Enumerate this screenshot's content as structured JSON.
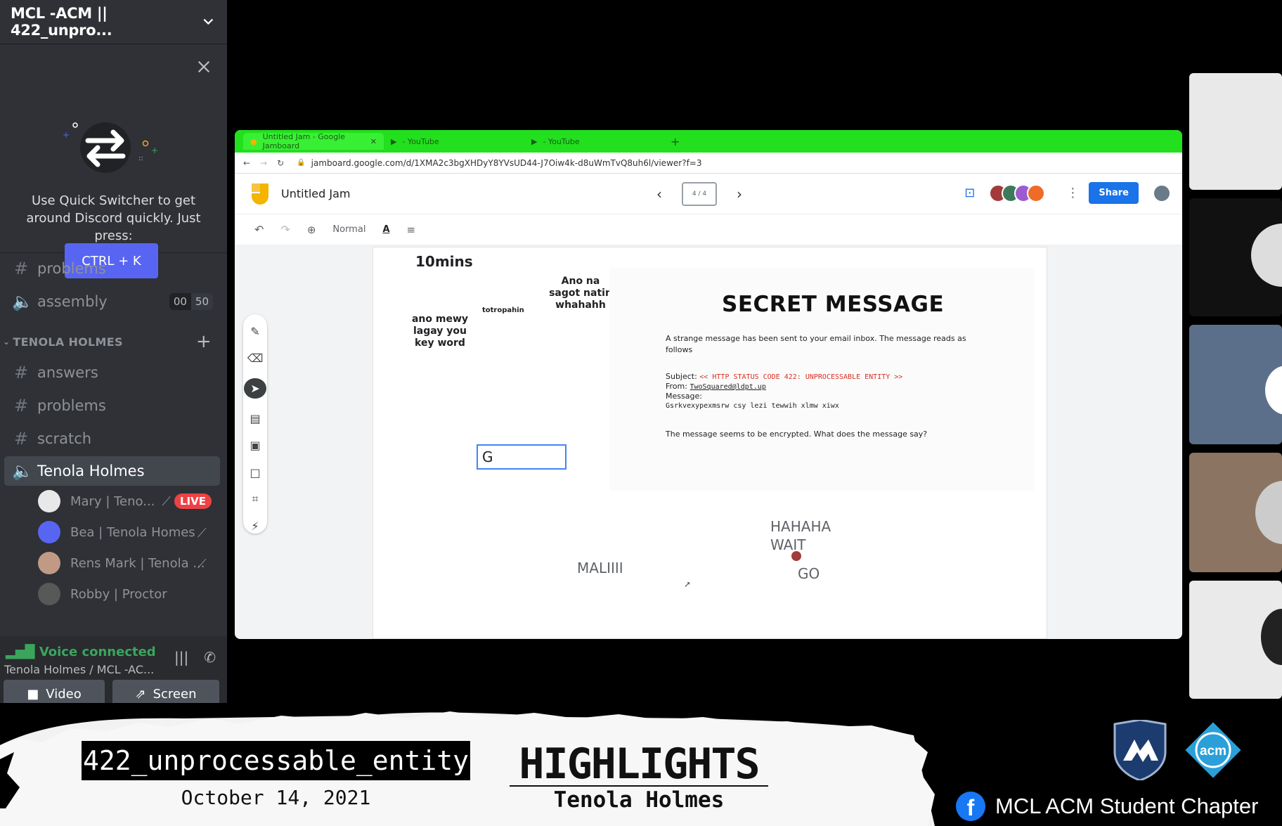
{
  "server": {
    "name": "MCL -ACM || 422_unpro..."
  },
  "quick_switcher": {
    "text": "Use Quick Switcher to get around Discord quickly. Just press:",
    "shortcut": "CTRL + K"
  },
  "channels": {
    "top": [
      {
        "name": "problems",
        "type": "text"
      },
      {
        "name": "assembly",
        "type": "voice",
        "counts": [
          "00",
          "50"
        ]
      }
    ],
    "category": "TENOLA HOLMES",
    "items": [
      {
        "name": "answers",
        "type": "text"
      },
      {
        "name": "problems",
        "type": "text"
      },
      {
        "name": "scratch",
        "type": "text"
      },
      {
        "name": "Tenola Holmes",
        "type": "voice"
      }
    ],
    "members": [
      {
        "name": "Mary | Teno...",
        "badge": "LIVE",
        "muted": true
      },
      {
        "name": "Bea | Tenola Homes",
        "muted": true
      },
      {
        "name": "Rens Mark | Tenola ...",
        "muted": true
      },
      {
        "name": "Robby | Proctor",
        "muted": false
      }
    ]
  },
  "voice": {
    "status": "Voice connected",
    "location": "Tenola Holmes / MCL -AC...",
    "video_label": "Video",
    "screen_label": "Screen"
  },
  "jamboard": {
    "url": "jamboard.google.com/d/1XMA2c3bgXHDyY8YVsUD44-J7Oiw4k-d8uWmTvQ8uh6l/viewer?f=3",
    "tabs": [
      "Untitled Jam - Google Jamboard",
      "- YouTube",
      "- YouTube"
    ],
    "title": "Untitled Jam",
    "frame_counter": "4 / 4",
    "share_label": "Share",
    "toolbar_font": "Normal",
    "notes": {
      "timer": "10mins",
      "ano_na": "Ano na sagot natin whahahh",
      "totropahin": "totropahin",
      "ano_mewy": "ano mewy lagay you key word"
    },
    "puzzle": {
      "title": "SECRET MESSAGE",
      "intro": "A strange message has been sent to your email inbox. The message reads as follows",
      "subject_label": "Subject:",
      "subject": "<< HTTP STATUS CODE 422: UNPROCESSABLE ENTITY >>",
      "from_label": "From:",
      "from": "TwoSquared@ldpt.up",
      "message_label": "Message:",
      "message": "Gsrkvexypexmsrw csy lezi tewwih xlmw xiwx",
      "question": "The message seems to be encrypted. What does the message say?"
    },
    "input_value": "G",
    "scribbles": {
      "hahaha": "HAHAHA",
      "wait": "WAIT",
      "go": "GO",
      "maliiii": "MALIIII"
    }
  },
  "banner": {
    "event": "422_unprocessable_entity",
    "date": "October 14, 2021",
    "title": "HIGHLIGHTS",
    "subtitle": "Tenola Holmes",
    "chapter": "MCL ACM Student Chapter",
    "acm_logo_text": "acm"
  },
  "colors": {
    "discord_sidebar": "#2f3136",
    "blurple": "#5865f2",
    "live_red": "#ed4245",
    "voice_green": "#3ba55d",
    "tab_green": "#22e01e",
    "share_blue": "#1a73e8"
  }
}
